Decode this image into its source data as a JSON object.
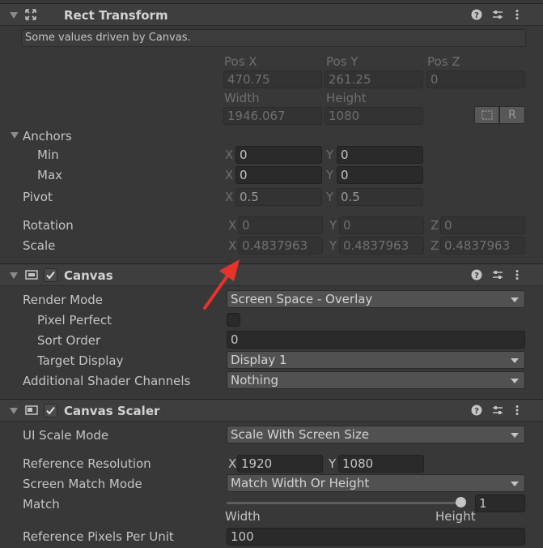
{
  "rect_transform": {
    "title": "Rect Transform",
    "info": "Some values driven by Canvas.",
    "labels": {
      "pos_x": "Pos X",
      "pos_y": "Pos Y",
      "pos_z": "Pos Z",
      "width": "Width",
      "height": "Height"
    },
    "values": {
      "pos_x": "470.75",
      "pos_y": "261.25",
      "pos_z": "0",
      "width": "1946.067",
      "height": "1080"
    },
    "raw_button": "R",
    "anchors": {
      "label": "Anchors",
      "min_label": "Min",
      "max_label": "Max",
      "min_x": "0",
      "min_y": "0",
      "max_x": "0",
      "max_y": "0"
    },
    "pivot": {
      "label": "Pivot",
      "x": "0.5",
      "y": "0.5"
    },
    "rotation": {
      "label": "Rotation",
      "x": "0",
      "y": "0",
      "z": "0"
    },
    "scale": {
      "label": "Scale",
      "x": "0.4837963",
      "y": "0.4837963",
      "z": "0.4837963"
    },
    "axes": {
      "x": "X",
      "y": "Y",
      "z": "Z"
    }
  },
  "canvas": {
    "title": "Canvas",
    "render_mode": {
      "label": "Render Mode",
      "value": "Screen Space - Overlay"
    },
    "pixel_perfect": {
      "label": "Pixel Perfect"
    },
    "sort_order": {
      "label": "Sort Order",
      "value": "0"
    },
    "target_display": {
      "label": "Target Display",
      "value": "Display 1"
    },
    "shader_channels": {
      "label": "Additional Shader Channels",
      "value": "Nothing"
    }
  },
  "canvas_scaler": {
    "title": "Canvas Scaler",
    "ui_scale_mode": {
      "label": "UI Scale Mode",
      "value": "Scale With Screen Size"
    },
    "reference_resolution": {
      "label": "Reference Resolution",
      "x": "1920",
      "y": "1080"
    },
    "screen_match_mode": {
      "label": "Screen Match Mode",
      "value": "Match Width Or Height"
    },
    "match": {
      "label": "Match",
      "value": "1",
      "slider_fraction": 1.0,
      "left_label": "Width",
      "right_label": "Height"
    },
    "pixels_per_unit": {
      "label": "Reference Pixels Per Unit",
      "value": "100"
    }
  },
  "colors": {
    "annotation_arrow": "#e8332c",
    "panel_bg": "#383838",
    "header_bg": "#3e3e3e"
  }
}
